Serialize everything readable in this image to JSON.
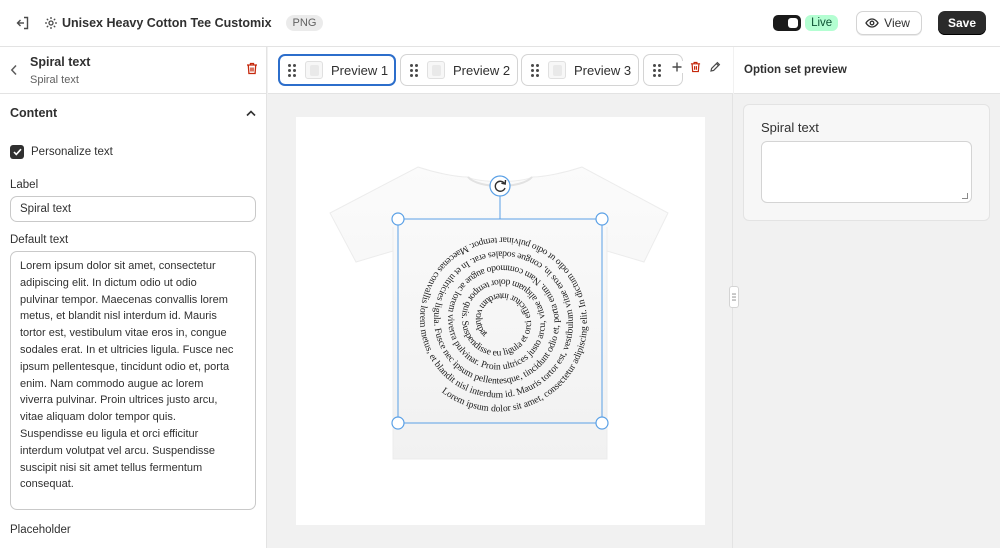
{
  "topbar": {
    "title": "Unisex Heavy Cotton Tee Customix",
    "badge": "PNG",
    "live_label": "Live",
    "view_label": "View",
    "save_label": "Save"
  },
  "left_panel": {
    "title": "Spiral text",
    "subtitle": "Spiral text",
    "section_title": "Content",
    "personalize_label": "Personalize text",
    "personalize_checked": true,
    "label_field_label": "Label",
    "label_value": "Spiral text",
    "default_text_label": "Default text",
    "default_text_lines": [
      "Lorem ipsum dolor sit amet, consectetur",
      "adipiscing elit. In dictum odio ut odio",
      "pulvinar tempor. Maecenas convallis lorem",
      "metus, et blandit nisl interdum id. Mauris",
      "tortor est, vestibulum vitae eros in, congue",
      "sodales erat. In et ultricies ligula. Fusce nec",
      "ipsum pellentesque, tincidunt odio et, porta",
      "enim. Nam commodo augue ac lorem",
      "viverra pulvinar. Proin ultrices justo arcu,",
      "vitae aliquam dolor tempor quis.",
      "Suspendisse eu ligula et orci efficitur",
      "interdum volutpat vel arcu. Suspendisse",
      "suscipit nisi sit amet tellus fermentum",
      "consequat."
    ],
    "placeholder_label": "Placeholder"
  },
  "tabs": [
    {
      "label": "Preview 1",
      "active": true
    },
    {
      "label": "Preview 2",
      "active": false
    },
    {
      "label": "Preview 3",
      "active": false
    }
  ],
  "spiral_text": "Lorem ipsum dolor sit amet, consectetur adipiscing elit. In dictum odio ut odio pulvinar tempor. Maecenas convallis lorem metus, et blandit nisl interdum id. Mauris tortor est, vestibulum vitae eros in, congue sodales erat. In et ultricies ligula. Fusce nec ipsum pellentesque, tincidunt odio et, porta enim. Nam commodo augue ac lorem viverra pulvinar. Proin ultrices justo arcu, vitae aliquam dolor tempor quis. Suspendisse eu ligula et orci efficitur interdum volutpat vel arcu. Suspendisse suscipit nisi sit amet tellus fermentum consequat.",
  "right_panel": {
    "title": "Option set preview",
    "field_label": "Spiral text",
    "field_value": ""
  },
  "colors": {
    "accent": "#2c6ecb",
    "live_bg": "#b4fed2",
    "danger": "#c5280c",
    "save_bg": "#2b2b2b"
  },
  "icons": [
    "exit-icon",
    "gear-icon",
    "eye-icon",
    "chevron-left-icon",
    "trash-icon",
    "chevron-up-icon",
    "checkmark-icon",
    "drag-handle-icon",
    "plus-icon",
    "pencil-icon",
    "rotate-icon"
  ]
}
